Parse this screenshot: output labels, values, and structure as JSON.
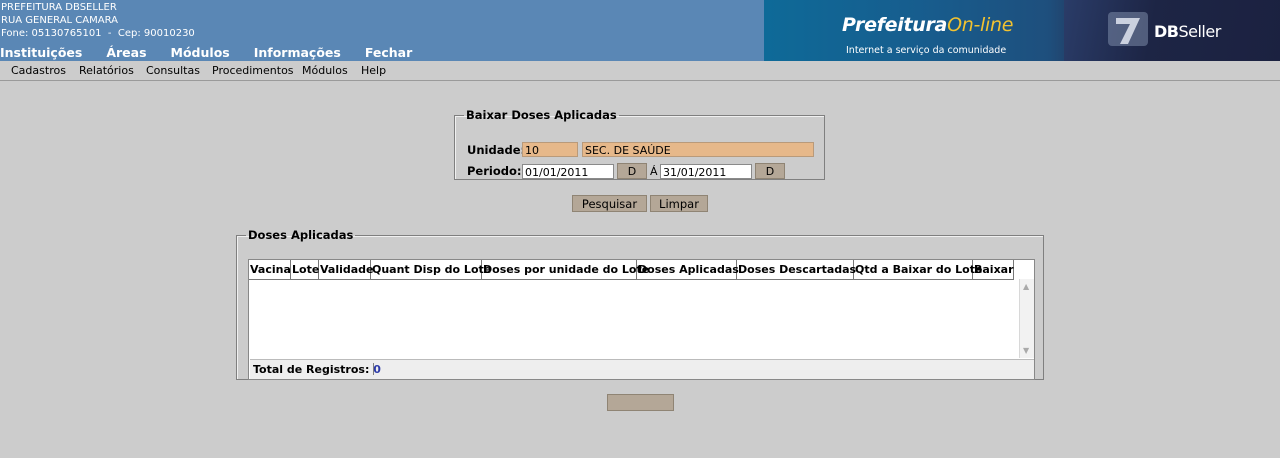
{
  "header": {
    "org_name": "PREFEITURA DBSELLER",
    "address": "RUA GENERAL CAMARA",
    "contact": "Fone: 05130765101  -  Cep: 90010230",
    "top_nav": [
      "Instituições",
      "Áreas",
      "Módulos",
      "Informações",
      "Fechar"
    ],
    "brand_main": "Prefeitura",
    "brand_online": "On-line",
    "brand_sub": "Internet a serviço da comunidade",
    "company_bold": "DB",
    "company_light": "Seller"
  },
  "menu": [
    "Cadastros",
    "Relatórios",
    "Consultas",
    "Procedimentos",
    "Módulos",
    "Help"
  ],
  "form": {
    "legend": "Baixar Doses Aplicadas",
    "unidade_label": "Unidade:",
    "unidade_code": "10",
    "unidade_name": "SEC. DE SAÚDE",
    "periodo_label": "Periodo:",
    "date_start": "01/01/2011",
    "date_button": "D",
    "separator": "Á",
    "date_end": "31/01/2011"
  },
  "actions": {
    "search": "Pesquisar",
    "clear": "Limpar",
    "bottom": ""
  },
  "grid": {
    "legend": "Doses Aplicadas",
    "columns": [
      "Vacina",
      "Lote",
      "Validade",
      "Quant Disp do Lote",
      "Doses por unidade do Lote",
      "Doses Aplicadas",
      "Doses Descartadas",
      "Qtd a Baixar do Lote",
      "Baixar"
    ],
    "rows": [],
    "total_label": "Total de Registros:",
    "total_value": "0"
  },
  "colors": {
    "header_bg": "#5a87b5",
    "readonly_field": "#e6b88a",
    "button": "#b4a797",
    "page_bg": "#cccccc"
  }
}
